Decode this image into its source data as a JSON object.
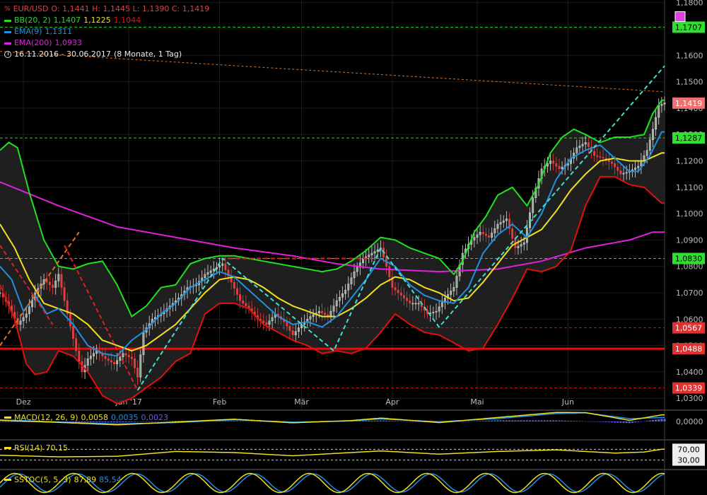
{
  "colors": {
    "background": "#000000",
    "bb_middle": "#f0e020",
    "bb_upper": "#20e020",
    "bb_lower": "#e01010",
    "ema9": "#2090e0",
    "ema200": "#e020e0",
    "support": "#e01010",
    "resistance": "#20e020",
    "trend_dash": "#40e0d0",
    "candle_up": "#e0e0e0",
    "candle_down": "#e04040",
    "macd_line": "#f0e020",
    "macd_signal": "#2090e0",
    "macd_hist": "#6060e0",
    "rsi": "#f0e020",
    "sstoc_k": "#f0e020",
    "sstoc_d": "#2090e0"
  },
  "legend": {
    "symbol": "EUR/USD",
    "ohlc": "O: 1,1441  H: 1,1445  L: 1,1390  C: 1,1419",
    "bb_label": "BB(20, 2)",
    "bb_mid": "1,1407",
    "bb_up": "1,1225",
    "bb_low": "1,1044",
    "ema9_label": "EMA(9)",
    "ema9_val": "1,1311",
    "ema200_label": "EMA(200)",
    "ema200_val": "1,0933",
    "range": "16.11.2016 - 30.06.2017",
    "period": "(8 Monate, 1 Tag)"
  },
  "macd_legend": {
    "label": "MACD(12, 26, 9)",
    "v1": "0,0058",
    "v2": "0,0035",
    "v3": "0,0023"
  },
  "rsi_legend": {
    "label": "RSI(14)",
    "v1": "70,15"
  },
  "sstoc_legend": {
    "label": "SSTOC(5, 5, 3)",
    "v1": "87,89",
    "v2": "85,54"
  },
  "chart_data": {
    "type": "candlestick",
    "symbol": "EUR/USD",
    "interval": "1 Tag",
    "date_range": [
      "16.11.2016",
      "30.06.2017"
    ],
    "x_months": [
      {
        "label": "Dez",
        "x": 8
      },
      {
        "label": "Jan '17",
        "x": 44
      },
      {
        "label": "Feb",
        "x": 75
      },
      {
        "label": "Mär",
        "x": 103
      },
      {
        "label": "Apr",
        "x": 134
      },
      {
        "label": "Mai",
        "x": 163
      },
      {
        "label": "Jun",
        "x": 194
      }
    ],
    "y_ticks": [
      "1,1800",
      "1,1700",
      "1,1600",
      "1,1500",
      "1,1400",
      "1,1300",
      "1,1200",
      "1,1100",
      "1,1000",
      "1,0900",
      "1,0800",
      "1,0700",
      "1,0600",
      "1,0500",
      "1,0400",
      "1,0300"
    ],
    "ylim": [
      1.0255,
      1.181
    ],
    "xlim": [
      0,
      227
    ],
    "price_marks": [
      {
        "value": 1.1707,
        "label": "1,1707",
        "kind": "resistance",
        "line": "dashed"
      },
      {
        "value": 1.1419,
        "label": "1,1419",
        "kind": "last",
        "line": "none"
      },
      {
        "value": 1.1287,
        "label": "1,1287",
        "kind": "resistance",
        "line": "dashed"
      },
      {
        "value": 1.083,
        "label": "1,0830",
        "kind": "resistance",
        "line": "dashed"
      },
      {
        "value": 1.0567,
        "label": "1,0567",
        "kind": "support",
        "line": "dashed"
      },
      {
        "value": 1.0488,
        "label": "1,0488",
        "kind": "support",
        "line": "solid"
      },
      {
        "value": 1.0339,
        "label": "1,0339",
        "kind": "support",
        "line": "dashed"
      }
    ],
    "ema200_key": [
      [
        0,
        1.112
      ],
      [
        20,
        1.103
      ],
      [
        40,
        1.095
      ],
      [
        60,
        1.091
      ],
      [
        80,
        1.087
      ],
      [
        100,
        1.084
      ],
      [
        115,
        1.081
      ],
      [
        130,
        1.079
      ],
      [
        150,
        1.078
      ],
      [
        170,
        1.079
      ],
      [
        185,
        1.082
      ],
      [
        200,
        1.087
      ],
      [
        215,
        1.09
      ],
      [
        223,
        1.093
      ]
    ],
    "bb_upper_key": [
      [
        0,
        1.124
      ],
      [
        3,
        1.127
      ],
      [
        6,
        1.125
      ],
      [
        10,
        1.108
      ],
      [
        15,
        1.09
      ],
      [
        20,
        1.08
      ],
      [
        25,
        1.079
      ],
      [
        30,
        1.081
      ],
      [
        35,
        1.082
      ],
      [
        40,
        1.073
      ],
      [
        45,
        1.061
      ],
      [
        50,
        1.065
      ],
      [
        55,
        1.072
      ],
      [
        60,
        1.073
      ],
      [
        65,
        1.081
      ],
      [
        70,
        1.083
      ],
      [
        75,
        1.084
      ],
      [
        80,
        1.084
      ],
      [
        85,
        1.083
      ],
      [
        90,
        1.082
      ],
      [
        95,
        1.081
      ],
      [
        100,
        1.08
      ],
      [
        105,
        1.079
      ],
      [
        110,
        1.078
      ],
      [
        115,
        1.079
      ],
      [
        120,
        1.082
      ],
      [
        125,
        1.086
      ],
      [
        130,
        1.091
      ],
      [
        135,
        1.09
      ],
      [
        140,
        1.087
      ],
      [
        145,
        1.085
      ],
      [
        150,
        1.083
      ],
      [
        155,
        1.077
      ],
      [
        158,
        1.082
      ],
      [
        162,
        1.093
      ],
      [
        166,
        1.099
      ],
      [
        170,
        1.107
      ],
      [
        175,
        1.11
      ],
      [
        180,
        1.103
      ],
      [
        184,
        1.111
      ],
      [
        188,
        1.123
      ],
      [
        192,
        1.129
      ],
      [
        196,
        1.132
      ],
      [
        200,
        1.13
      ],
      [
        205,
        1.127
      ],
      [
        210,
        1.129
      ],
      [
        215,
        1.129
      ],
      [
        220,
        1.13
      ],
      [
        223,
        1.138
      ],
      [
        226,
        1.143
      ]
    ],
    "bb_lower_key": [
      [
        0,
        1.073
      ],
      [
        5,
        1.06
      ],
      [
        9,
        1.043
      ],
      [
        12,
        1.039
      ],
      [
        16,
        1.04
      ],
      [
        20,
        1.048
      ],
      [
        25,
        1.046
      ],
      [
        30,
        1.04
      ],
      [
        35,
        1.031
      ],
      [
        40,
        1.028
      ],
      [
        45,
        1.03
      ],
      [
        50,
        1.034
      ],
      [
        55,
        1.038
      ],
      [
        60,
        1.044
      ],
      [
        65,
        1.047
      ],
      [
        70,
        1.062
      ],
      [
        75,
        1.066
      ],
      [
        80,
        1.066
      ],
      [
        85,
        1.064
      ],
      [
        90,
        1.058
      ],
      [
        95,
        1.055
      ],
      [
        100,
        1.052
      ],
      [
        105,
        1.05
      ],
      [
        110,
        1.047
      ],
      [
        115,
        1.048
      ],
      [
        120,
        1.047
      ],
      [
        125,
        1.049
      ],
      [
        130,
        1.055
      ],
      [
        135,
        1.062
      ],
      [
        140,
        1.058
      ],
      [
        145,
        1.055
      ],
      [
        150,
        1.054
      ],
      [
        155,
        1.051
      ],
      [
        160,
        1.048
      ],
      [
        165,
        1.049
      ],
      [
        170,
        1.058
      ],
      [
        175,
        1.068
      ],
      [
        180,
        1.079
      ],
      [
        185,
        1.078
      ],
      [
        190,
        1.08
      ],
      [
        195,
        1.086
      ],
      [
        200,
        1.103
      ],
      [
        205,
        1.114
      ],
      [
        210,
        1.114
      ],
      [
        215,
        1.111
      ],
      [
        220,
        1.11
      ],
      [
        226,
        1.104
      ]
    ],
    "bb_middle_key": [
      [
        0,
        1.096
      ],
      [
        5,
        1.087
      ],
      [
        10,
        1.075
      ],
      [
        15,
        1.066
      ],
      [
        20,
        1.064
      ],
      [
        25,
        1.062
      ],
      [
        30,
        1.058
      ],
      [
        35,
        1.052
      ],
      [
        40,
        1.05
      ],
      [
        45,
        1.048
      ],
      [
        50,
        1.05
      ],
      [
        55,
        1.054
      ],
      [
        60,
        1.058
      ],
      [
        65,
        1.064
      ],
      [
        70,
        1.07
      ],
      [
        75,
        1.075
      ],
      [
        80,
        1.076
      ],
      [
        85,
        1.075
      ],
      [
        90,
        1.072
      ],
      [
        95,
        1.068
      ],
      [
        100,
        1.065
      ],
      [
        105,
        1.063
      ],
      [
        110,
        1.061
      ],
      [
        115,
        1.061
      ],
      [
        120,
        1.064
      ],
      [
        125,
        1.068
      ],
      [
        130,
        1.073
      ],
      [
        135,
        1.076
      ],
      [
        140,
        1.075
      ],
      [
        145,
        1.072
      ],
      [
        150,
        1.07
      ],
      [
        155,
        1.067
      ],
      [
        160,
        1.068
      ],
      [
        165,
        1.074
      ],
      [
        170,
        1.081
      ],
      [
        175,
        1.088
      ],
      [
        180,
        1.091
      ],
      [
        185,
        1.094
      ],
      [
        190,
        1.101
      ],
      [
        195,
        1.109
      ],
      [
        200,
        1.115
      ],
      [
        205,
        1.12
      ],
      [
        210,
        1.121
      ],
      [
        215,
        1.12
      ],
      [
        220,
        1.12
      ],
      [
        226,
        1.123
      ]
    ],
    "ema9_key": [
      [
        0,
        1.08
      ],
      [
        4,
        1.075
      ],
      [
        8,
        1.063
      ],
      [
        12,
        1.069
      ],
      [
        16,
        1.062
      ],
      [
        20,
        1.064
      ],
      [
        25,
        1.058
      ],
      [
        30,
        1.05
      ],
      [
        35,
        1.047
      ],
      [
        40,
        1.046
      ],
      [
        45,
        1.052
      ],
      [
        50,
        1.056
      ],
      [
        55,
        1.062
      ],
      [
        60,
        1.066
      ],
      [
        65,
        1.072
      ],
      [
        70,
        1.075
      ],
      [
        75,
        1.078
      ],
      [
        80,
        1.076
      ],
      [
        85,
        1.071
      ],
      [
        90,
        1.066
      ],
      [
        95,
        1.061
      ],
      [
        100,
        1.058
      ],
      [
        105,
        1.059
      ],
      [
        110,
        1.057
      ],
      [
        115,
        1.061
      ],
      [
        120,
        1.068
      ],
      [
        125,
        1.075
      ],
      [
        130,
        1.083
      ],
      [
        135,
        1.08
      ],
      [
        140,
        1.073
      ],
      [
        145,
        1.069
      ],
      [
        150,
        1.067
      ],
      [
        155,
        1.066
      ],
      [
        160,
        1.072
      ],
      [
        165,
        1.085
      ],
      [
        170,
        1.092
      ],
      [
        175,
        1.096
      ],
      [
        180,
        1.091
      ],
      [
        185,
        1.1
      ],
      [
        190,
        1.113
      ],
      [
        195,
        1.121
      ],
      [
        200,
        1.124
      ],
      [
        205,
        1.126
      ],
      [
        210,
        1.121
      ],
      [
        215,
        1.116
      ],
      [
        218,
        1.116
      ],
      [
        222,
        1.122
      ],
      [
        226,
        1.131
      ]
    ],
    "close_key": [
      [
        0,
        1.07
      ],
      [
        3,
        1.065
      ],
      [
        6,
        1.058
      ],
      [
        9,
        1.062
      ],
      [
        12,
        1.07
      ],
      [
        15,
        1.075
      ],
      [
        18,
        1.072
      ],
      [
        20,
        1.077
      ],
      [
        23,
        1.062
      ],
      [
        26,
        1.048
      ],
      [
        28,
        1.04
      ],
      [
        30,
        1.045
      ],
      [
        33,
        1.048
      ],
      [
        36,
        1.045
      ],
      [
        39,
        1.043
      ],
      [
        42,
        1.047
      ],
      [
        45,
        1.045
      ],
      [
        47,
        1.038
      ],
      [
        49,
        1.055
      ],
      [
        52,
        1.06
      ],
      [
        55,
        1.062
      ],
      [
        58,
        1.065
      ],
      [
        61,
        1.068
      ],
      [
        64,
        1.072
      ],
      [
        67,
        1.073
      ],
      [
        70,
        1.077
      ],
      [
        73,
        1.079
      ],
      [
        76,
        1.081
      ],
      [
        79,
        1.074
      ],
      [
        82,
        1.067
      ],
      [
        85,
        1.064
      ],
      [
        88,
        1.06
      ],
      [
        91,
        1.058
      ],
      [
        94,
        1.062
      ],
      [
        97,
        1.059
      ],
      [
        100,
        1.054
      ],
      [
        103,
        1.058
      ],
      [
        106,
        1.061
      ],
      [
        109,
        1.063
      ],
      [
        112,
        1.061
      ],
      [
        115,
        1.067
      ],
      [
        118,
        1.071
      ],
      [
        121,
        1.078
      ],
      [
        124,
        1.083
      ],
      [
        127,
        1.085
      ],
      [
        130,
        1.087
      ],
      [
        132,
        1.08
      ],
      [
        134,
        1.072
      ],
      [
        136,
        1.07
      ],
      [
        138,
        1.068
      ],
      [
        140,
        1.066
      ],
      [
        143,
        1.066
      ],
      [
        146,
        1.062
      ],
      [
        149,
        1.063
      ],
      [
        152,
        1.068
      ],
      [
        155,
        1.072
      ],
      [
        158,
        1.085
      ],
      [
        161,
        1.09
      ],
      [
        164,
        1.093
      ],
      [
        167,
        1.091
      ],
      [
        170,
        1.096
      ],
      [
        173,
        1.098
      ],
      [
        176,
        1.087
      ],
      [
        179,
        1.089
      ],
      [
        182,
        1.106
      ],
      [
        185,
        1.117
      ],
      [
        188,
        1.12
      ],
      [
        191,
        1.117
      ],
      [
        194,
        1.119
      ],
      [
        197,
        1.125
      ],
      [
        200,
        1.127
      ],
      [
        203,
        1.122
      ],
      [
        206,
        1.121
      ],
      [
        209,
        1.119
      ],
      [
        212,
        1.115
      ],
      [
        215,
        1.116
      ],
      [
        218,
        1.118
      ],
      [
        221,
        1.124
      ],
      [
        223,
        1.132
      ],
      [
        225,
        1.141
      ],
      [
        227,
        1.142
      ]
    ],
    "macd_key": [
      [
        0,
        0.001
      ],
      [
        20,
        -0.0008
      ],
      [
        40,
        -0.003
      ],
      [
        60,
        -0.0005
      ],
      [
        80,
        0.002
      ],
      [
        100,
        -0.0012
      ],
      [
        120,
        0.0008
      ],
      [
        130,
        0.003
      ],
      [
        150,
        -0.001
      ],
      [
        170,
        0.0035
      ],
      [
        190,
        0.008
      ],
      [
        200,
        0.0078
      ],
      [
        215,
        0.001
      ],
      [
        226,
        0.0058
      ]
    ],
    "macd_signal_key": [
      [
        0,
        0.0015
      ],
      [
        20,
        -0.0004
      ],
      [
        40,
        -0.0022
      ],
      [
        60,
        -0.001
      ],
      [
        80,
        0.0015
      ],
      [
        100,
        -0.0005
      ],
      [
        120,
        0.0004
      ],
      [
        130,
        0.0022
      ],
      [
        150,
        -0.0002
      ],
      [
        170,
        0.0025
      ],
      [
        190,
        0.007
      ],
      [
        200,
        0.0076
      ],
      [
        215,
        0.0025
      ],
      [
        226,
        0.0035
      ]
    ],
    "rsi_key": [
      [
        0,
        48
      ],
      [
        20,
        42
      ],
      [
        40,
        44
      ],
      [
        60,
        62
      ],
      [
        80,
        58
      ],
      [
        100,
        46
      ],
      [
        120,
        58
      ],
      [
        130,
        64
      ],
      [
        150,
        52
      ],
      [
        170,
        62
      ],
      [
        190,
        68
      ],
      [
        210,
        56
      ],
      [
        220,
        60
      ],
      [
        226,
        70.15
      ]
    ],
    "rsi_levels": [
      70,
      30
    ],
    "rsi_level_labels": [
      "70,00",
      "30,00"
    ]
  }
}
